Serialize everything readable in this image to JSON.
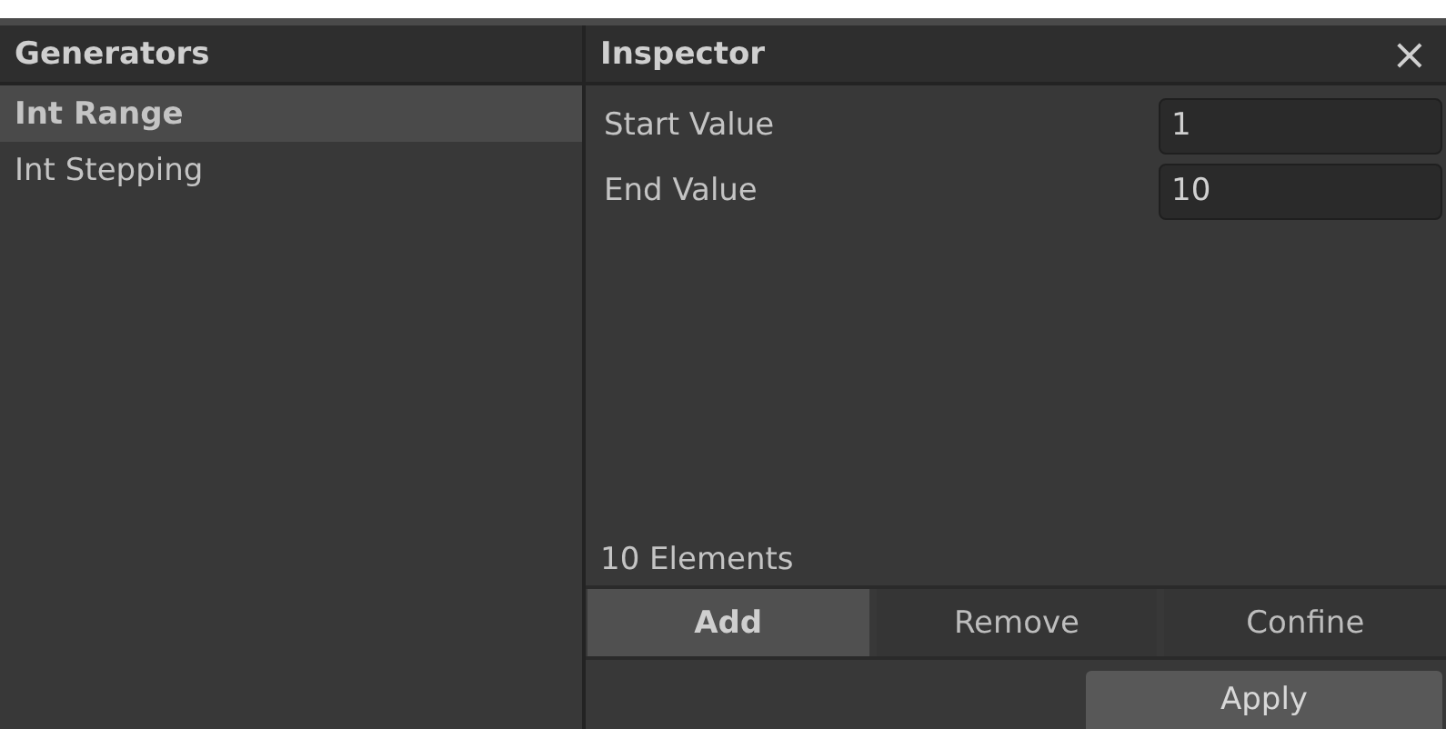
{
  "generators": {
    "title": "Generators",
    "items": [
      {
        "label": "Int Range",
        "selected": true
      },
      {
        "label": "Int Stepping",
        "selected": false
      }
    ]
  },
  "inspector": {
    "title": "Inspector",
    "close": "×",
    "fields": [
      {
        "label": "Start Value",
        "value": "1"
      },
      {
        "label": "End Value",
        "value": "10"
      }
    ],
    "count": "10 Elements",
    "actions": [
      {
        "label": "Add",
        "selected": true
      },
      {
        "label": "Remove",
        "selected": false
      },
      {
        "label": "Confine",
        "selected": false
      }
    ],
    "apply": "Apply"
  }
}
